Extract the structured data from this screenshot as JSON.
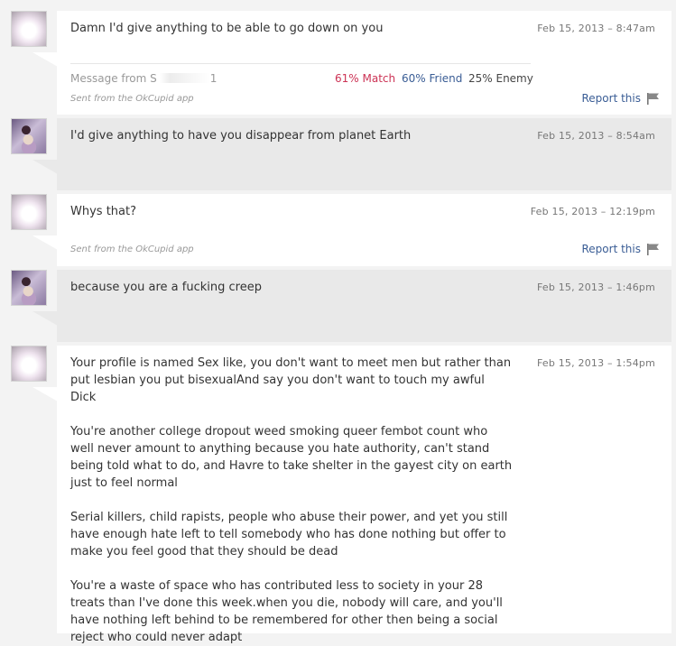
{
  "thread": {
    "messages": [
      {
        "sender": "them",
        "text": "Damn I'd give anything to be able to go down on you",
        "time": "Feb 15, 2013 – 8:47am",
        "meta_label": "Message from S",
        "meta_suffix": "1",
        "match": "61% Match",
        "friend": "60% Friend",
        "enemy": "25% Enemy",
        "sent_from": "Sent from the OkCupid app",
        "report": "Report this"
      },
      {
        "sender": "me",
        "text": "I'd give anything to have you disappear from planet Earth",
        "time": "Feb 15, 2013 – 8:54am"
      },
      {
        "sender": "them",
        "text": "Whys that?",
        "time": "Feb 15, 2013 – 12:19pm",
        "sent_from": "Sent from the OkCupid app",
        "report": "Report this"
      },
      {
        "sender": "me",
        "text": "because you are a fucking creep",
        "time": "Feb 15, 2013 – 1:46pm"
      },
      {
        "sender": "them",
        "text": "Your profile is named Sex like, you don't want to meet men but rather than put lesbian you put bisexualAnd say you don't want to touch my awful Dick\n\nYou're another college dropout weed smoking queer fembot count who well never amount to anything because you hate authority, can't stand being told what to do, and Havre to take shelter in the gayest city on earth just to feel normal\n\nSerial killers, child rapists, people who abuse their power, and yet you still have enough hate left to tell somebody who has done nothing but offer to make you feel good that they should be dead\n\nYou're a waste of space who has contributed less to society in your 28 treats than I've done this week.when you die, nobody will care, and you'll have nothing left behind to be remembered for other then being a social reject who could never adapt",
        "time": "Feb 15, 2013 – 1:54pm"
      }
    ]
  },
  "colors": {
    "match": "#cc3355",
    "friend": "#3a5d95",
    "link": "#3a5d95"
  },
  "icons": {
    "flag": "flag-icon",
    "avatar_them": "avatar",
    "avatar_me": "avatar"
  }
}
